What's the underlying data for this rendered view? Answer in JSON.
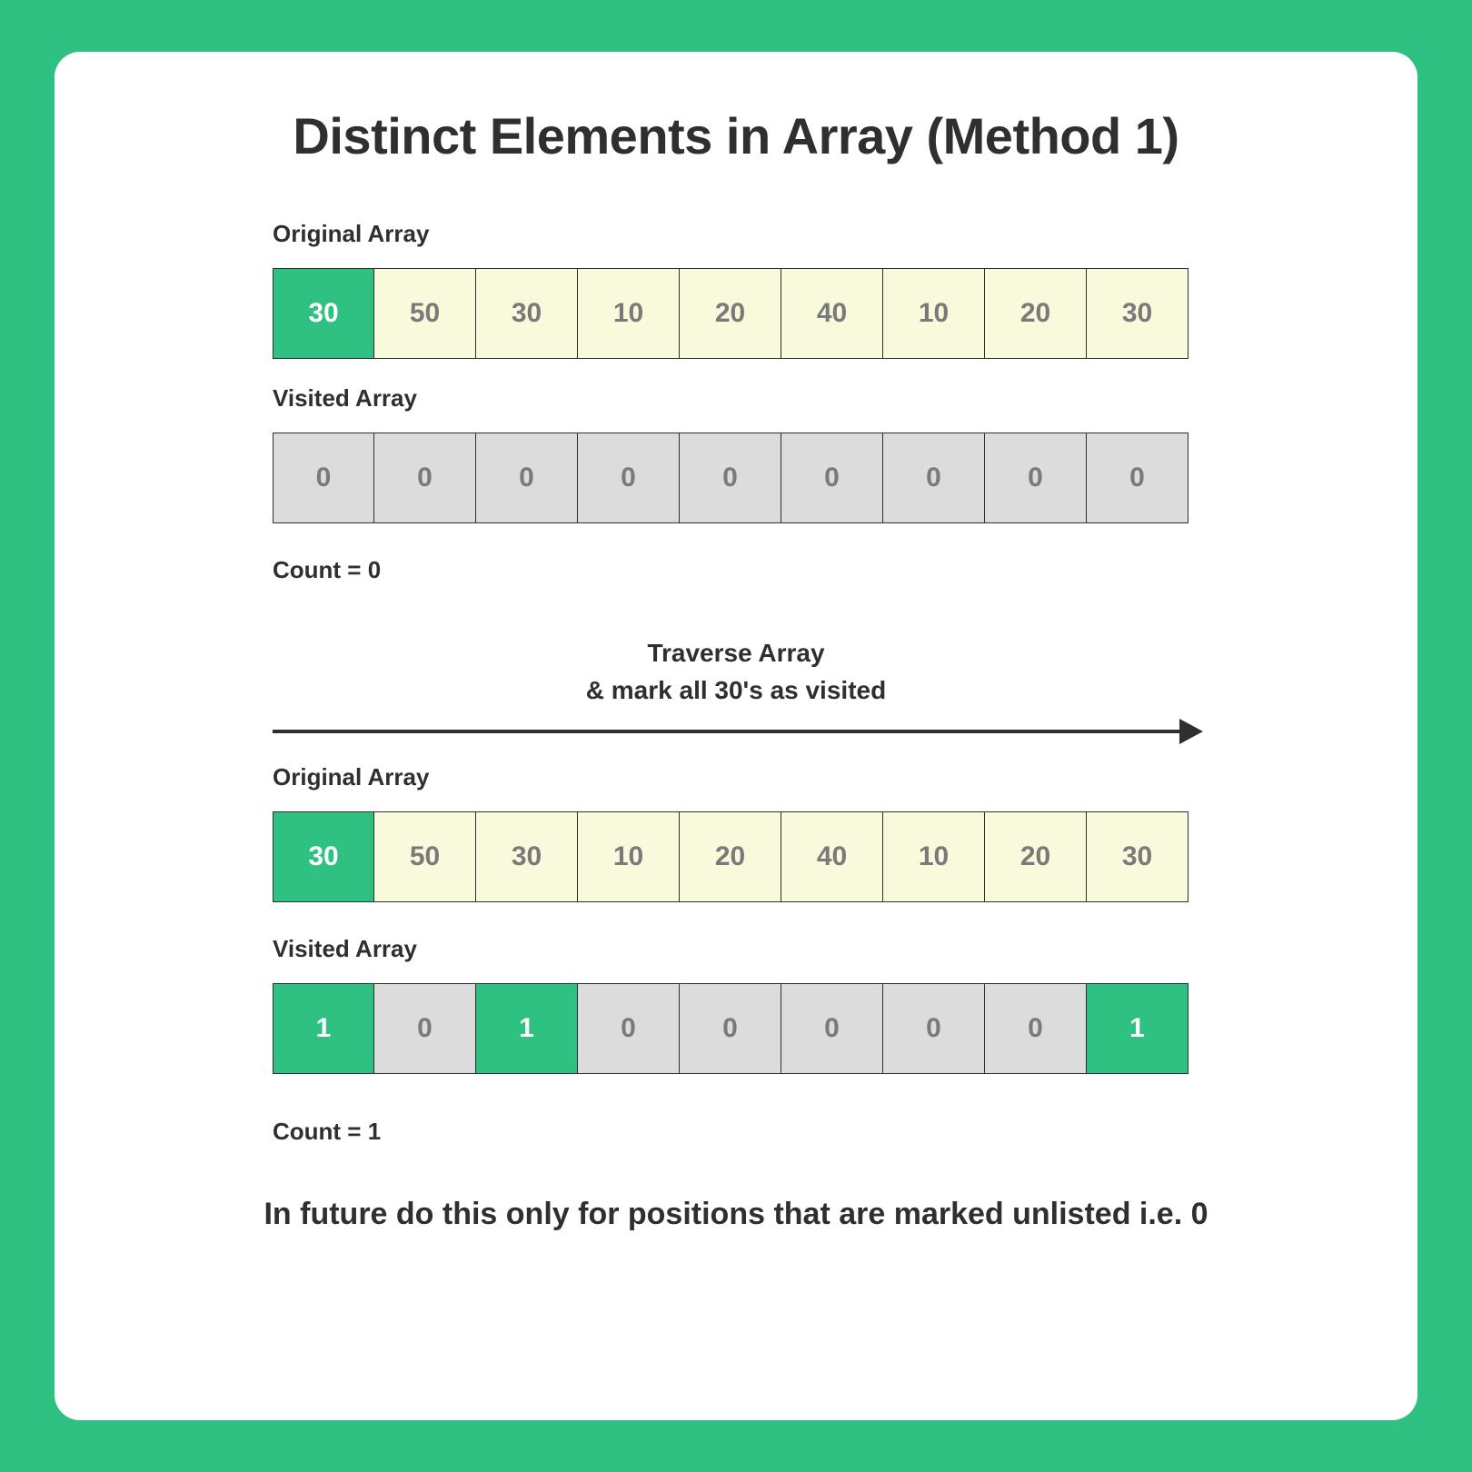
{
  "title": "Distinct Elements in Array (Method 1)",
  "labels": {
    "original": "Original Array",
    "visited": "Visited Array",
    "count0": "Count = 0",
    "count1": "Count = 1"
  },
  "traverse": {
    "line1": "Traverse Array",
    "line2": "& mark all 30's as visited"
  },
  "step1": {
    "original": [
      {
        "v": "30",
        "hl": true
      },
      {
        "v": "50",
        "hl": false
      },
      {
        "v": "30",
        "hl": false
      },
      {
        "v": "10",
        "hl": false
      },
      {
        "v": "20",
        "hl": false
      },
      {
        "v": "40",
        "hl": false
      },
      {
        "v": "10",
        "hl": false
      },
      {
        "v": "20",
        "hl": false
      },
      {
        "v": "30",
        "hl": false
      }
    ],
    "visited": [
      {
        "v": "0",
        "hl": false
      },
      {
        "v": "0",
        "hl": false
      },
      {
        "v": "0",
        "hl": false
      },
      {
        "v": "0",
        "hl": false
      },
      {
        "v": "0",
        "hl": false
      },
      {
        "v": "0",
        "hl": false
      },
      {
        "v": "0",
        "hl": false
      },
      {
        "v": "0",
        "hl": false
      },
      {
        "v": "0",
        "hl": false
      }
    ]
  },
  "step2": {
    "original": [
      {
        "v": "30",
        "hl": true
      },
      {
        "v": "50",
        "hl": false
      },
      {
        "v": "30",
        "hl": false
      },
      {
        "v": "10",
        "hl": false
      },
      {
        "v": "20",
        "hl": false
      },
      {
        "v": "40",
        "hl": false
      },
      {
        "v": "10",
        "hl": false
      },
      {
        "v": "20",
        "hl": false
      },
      {
        "v": "30",
        "hl": false
      }
    ],
    "visited": [
      {
        "v": "1",
        "hl": true
      },
      {
        "v": "0",
        "hl": false
      },
      {
        "v": "1",
        "hl": true
      },
      {
        "v": "0",
        "hl": false
      },
      {
        "v": "0",
        "hl": false
      },
      {
        "v": "0",
        "hl": false
      },
      {
        "v": "0",
        "hl": false
      },
      {
        "v": "0",
        "hl": false
      },
      {
        "v": "1",
        "hl": true
      }
    ]
  },
  "footer": "In future do this only for positions that are marked unlisted i.e. 0",
  "chart_data": {
    "type": "table",
    "title": "Distinct Elements in Array (Method 1)",
    "original_array": [
      30,
      50,
      30,
      10,
      20,
      40,
      10,
      20,
      30
    ],
    "step1": {
      "visited": [
        0,
        0,
        0,
        0,
        0,
        0,
        0,
        0,
        0
      ],
      "count": 0,
      "current_index": 0
    },
    "step2": {
      "visited": [
        1,
        0,
        1,
        0,
        0,
        0,
        0,
        0,
        1
      ],
      "count": 1,
      "marked_value": 30
    },
    "note": "In future do this only for positions that are marked unlisted i.e. 0"
  }
}
